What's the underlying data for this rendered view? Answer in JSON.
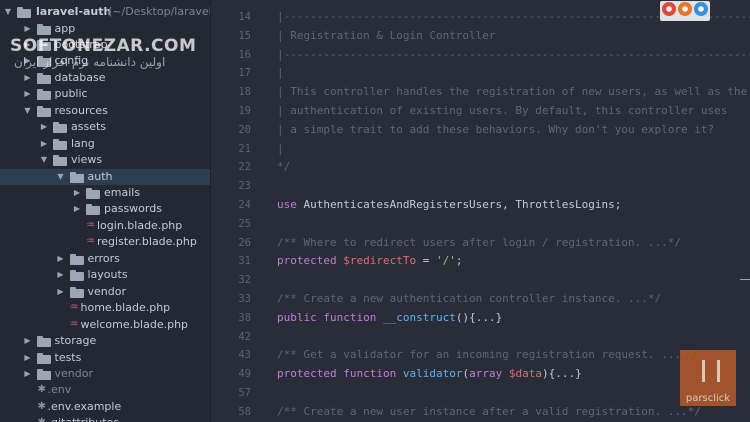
{
  "sidebar": {
    "root": {
      "name": "laravel-auth",
      "path": "(~/Desktop/laravel-a"
    },
    "items": [
      {
        "label": "app",
        "type": "folder",
        "depth": 1,
        "expanded": false
      },
      {
        "label": "bootstrap",
        "type": "folder",
        "depth": 1,
        "expanded": false
      },
      {
        "label": "config",
        "type": "folder",
        "depth": 1,
        "expanded": false
      },
      {
        "label": "database",
        "type": "folder",
        "depth": 1,
        "expanded": false
      },
      {
        "label": "public",
        "type": "folder",
        "depth": 1,
        "expanded": false
      },
      {
        "label": "resources",
        "type": "folder",
        "depth": 1,
        "expanded": true
      },
      {
        "label": "assets",
        "type": "folder",
        "depth": 2,
        "expanded": false
      },
      {
        "label": "lang",
        "type": "folder",
        "depth": 2,
        "expanded": false
      },
      {
        "label": "views",
        "type": "folder",
        "depth": 2,
        "expanded": true
      },
      {
        "label": "auth",
        "type": "folder",
        "depth": 3,
        "expanded": true,
        "selected": true
      },
      {
        "label": "emails",
        "type": "folder",
        "depth": 4,
        "expanded": false
      },
      {
        "label": "passwords",
        "type": "folder",
        "depth": 4,
        "expanded": false
      },
      {
        "label": "login.blade.php",
        "type": "file",
        "depth": 4
      },
      {
        "label": "register.blade.php",
        "type": "file",
        "depth": 4
      },
      {
        "label": "errors",
        "type": "folder",
        "depth": 3,
        "expanded": false
      },
      {
        "label": "layouts",
        "type": "folder",
        "depth": 3,
        "expanded": false
      },
      {
        "label": "vendor",
        "type": "folder",
        "depth": 3,
        "expanded": false
      },
      {
        "label": "home.blade.php",
        "type": "file",
        "depth": 3
      },
      {
        "label": "welcome.blade.php",
        "type": "file",
        "depth": 3
      },
      {
        "label": "storage",
        "type": "folder",
        "depth": 1,
        "expanded": false
      },
      {
        "label": "tests",
        "type": "folder",
        "depth": 1,
        "expanded": false
      },
      {
        "label": "vendor",
        "type": "folder",
        "depth": 1,
        "expanded": false,
        "dim": true
      },
      {
        "label": ".env",
        "type": "dotfile",
        "depth": 1,
        "dim": true
      },
      {
        "label": ".env.example",
        "type": "dotfile",
        "depth": 1
      },
      {
        "label": ".gitattributes",
        "type": "dotfile",
        "depth": 1
      }
    ]
  },
  "editor": {
    "lines": [
      {
        "n": "14",
        "html": "<span class=\"cm\">|------------------------------------------------------------------------</span>"
      },
      {
        "n": "15",
        "html": "<span class=\"cm\">| Registration &amp; Login Controller</span>"
      },
      {
        "n": "16",
        "html": "<span class=\"cm\">|------------------------------------------------------------------------</span>"
      },
      {
        "n": "17",
        "html": "<span class=\"cm\">|</span>"
      },
      {
        "n": "18",
        "html": "<span class=\"cm\">| This controller handles the registration of new users, as well as the</span>"
      },
      {
        "n": "19",
        "html": "<span class=\"cm\">| authentication of existing users. By default, this controller uses</span>"
      },
      {
        "n": "20",
        "html": "<span class=\"cm\">| a simple trait to add these behaviors. Why don't you explore it?</span>"
      },
      {
        "n": "21",
        "html": "<span class=\"cm\">|</span>"
      },
      {
        "n": "22",
        "html": "<span class=\"cm\">*/</span>"
      },
      {
        "n": "23",
        "html": ""
      },
      {
        "n": "24",
        "html": "<span class=\"kw\">use</span> AuthenticatesAndRegistersUsers, ThrottlesLogins;"
      },
      {
        "n": "25",
        "html": ""
      },
      {
        "n": "26",
        "html": "<span class=\"cm\">/** Where to redirect users after login / registration. ...*/</span>"
      },
      {
        "n": "31",
        "html": "<span class=\"kw\">protected</span> <span class=\"var\">$redirectTo</span> = <span class=\"str\">'/'</span>;"
      },
      {
        "n": "32",
        "html": ""
      },
      {
        "n": "33",
        "html": "<span class=\"cm\">/** Create a new authentication controller instance. ...*/</span>"
      },
      {
        "n": "38",
        "html": "<span class=\"kw\">public</span> <span class=\"kw\">function</span> <span class=\"fn\">__construct</span>(){...}"
      },
      {
        "n": "42",
        "html": ""
      },
      {
        "n": "43",
        "html": "<span class=\"cm\">/** Get a validator for an incoming registration request. ...*/</span>"
      },
      {
        "n": "49",
        "html": "<span class=\"kw\">protected</span> <span class=\"kw\">function</span> <span class=\"fn\">validator</span>(<span class=\"kw\">array</span> <span class=\"var\">$data</span>){...}"
      },
      {
        "n": "57",
        "html": ""
      },
      {
        "n": "58",
        "html": "<span class=\"cm\">/** Create a new user instance after a valid registration. ...*/</span>"
      }
    ]
  },
  "browsers": [
    {
      "name": "chrome-icon",
      "color": "#e2483a"
    },
    {
      "name": "firefox-icon",
      "color": "#e8752a"
    },
    {
      "name": "safari-icon",
      "color": "#3b8fd6"
    }
  ],
  "watermark": {
    "text": "SOFTONEZAR.COM",
    "subtext": "اولین دانشنامه نرم افزار ایران"
  },
  "logo": {
    "text": "parsclick"
  }
}
